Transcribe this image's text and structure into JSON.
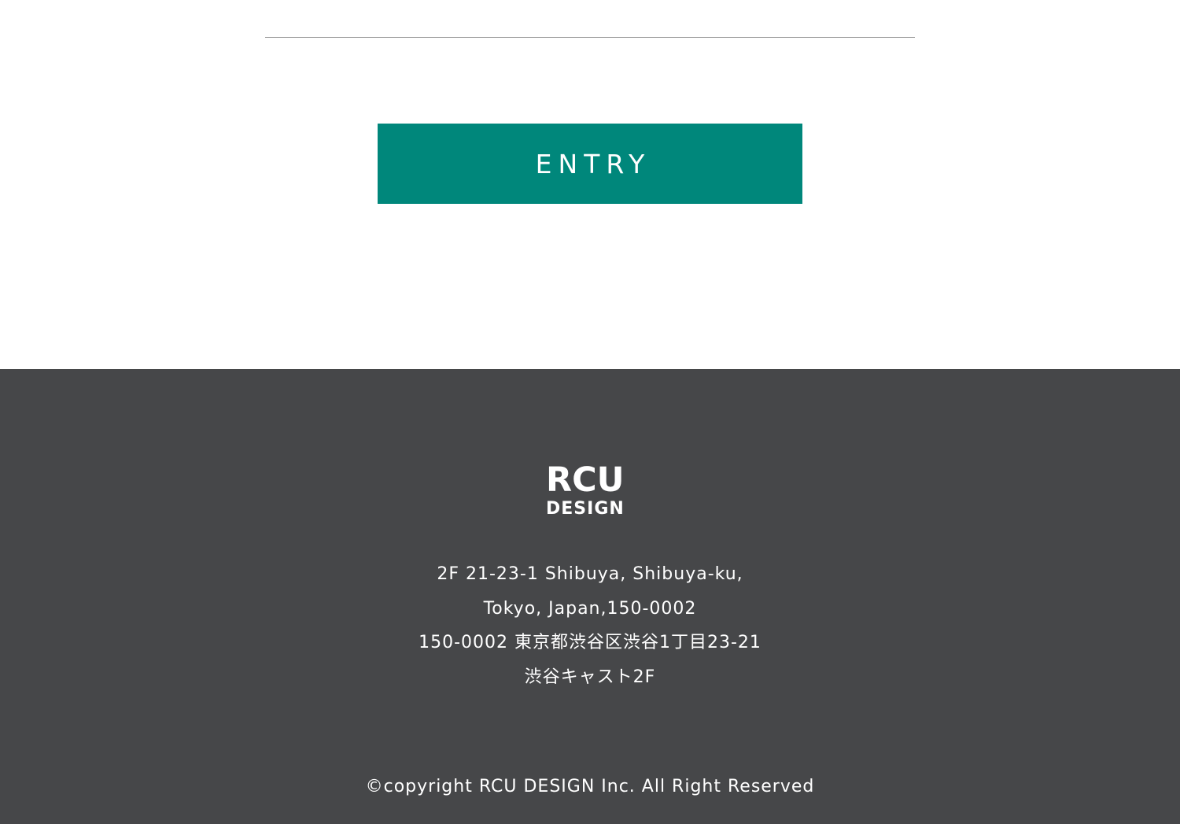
{
  "entry": {
    "label": "ENTRY"
  },
  "footer": {
    "logo": {
      "line1": "RCU",
      "line2": "DESIGN"
    },
    "address": [
      "2F 21-23-1 Shibuya, Shibuya-ku,",
      "Tokyo, Japan,150-0002",
      "150-0002 東京都渋谷区渋谷1丁目23-21",
      "渋谷キャスト2F"
    ],
    "copyright": "©copyright RCU DESIGN Inc. All Right Reserved"
  },
  "colors": {
    "accent": "#00877b",
    "footer_bg": "#464749",
    "divider": "#9a9a9a"
  }
}
